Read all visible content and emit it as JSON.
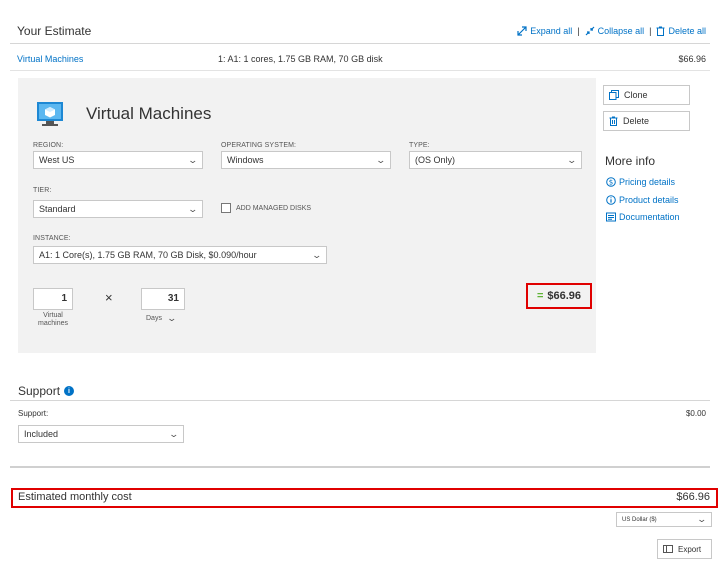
{
  "header": {
    "title": "Your Estimate",
    "expand_all": "Expand all",
    "collapse_all": "Collapse all",
    "delete_all": "Delete all",
    "separator": "|"
  },
  "vm_row": {
    "name": "Virtual Machines",
    "description": "1: A1: 1 cores, 1.75 GB RAM, 70 GB disk",
    "price": "$66.96"
  },
  "vm_panel": {
    "title": "Virtual Machines",
    "region": {
      "label": "REGION:",
      "value": "West US"
    },
    "os": {
      "label": "OPERATING SYSTEM:",
      "value": "Windows"
    },
    "type": {
      "label": "TYPE:",
      "value": "(OS Only)"
    },
    "tier": {
      "label": "TIER:",
      "value": "Standard"
    },
    "managed_disks_label": "ADD MANAGED DISKS",
    "instance": {
      "label": "INSTANCE:",
      "value": "A1: 1 Core(s), 1.75 GB RAM, 70 GB Disk, $0.090/hour"
    },
    "quantity": {
      "value": "1",
      "caption_line1": "Virtual",
      "caption_line2": "machines"
    },
    "times": "×",
    "days": {
      "value": "31",
      "unit": "Days"
    },
    "equals": "=",
    "subtotal": "$66.96"
  },
  "actions": {
    "clone": "Clone",
    "delete": "Delete"
  },
  "more_info": {
    "title": "More info",
    "links": [
      "Pricing details",
      "Product details",
      "Documentation"
    ]
  },
  "support": {
    "title": "Support",
    "label": "Support:",
    "value": "Included",
    "price": "$0.00"
  },
  "estimate": {
    "label": "Estimated monthly cost",
    "total": "$66.96",
    "currency": "US Dollar ($)",
    "export": "Export"
  },
  "colors": {
    "accent": "#0072c6",
    "highlight": "#e00000",
    "equals": "#5fb336",
    "panel": "#f2f2f2"
  },
  "icons": [
    "expand-icon",
    "collapse-icon",
    "delete-icon",
    "virtual-machine-icon",
    "chevron-down-icon",
    "clone-icon",
    "trash-icon",
    "pricing-icon",
    "info-icon",
    "documentation-icon",
    "export-icon"
  ]
}
